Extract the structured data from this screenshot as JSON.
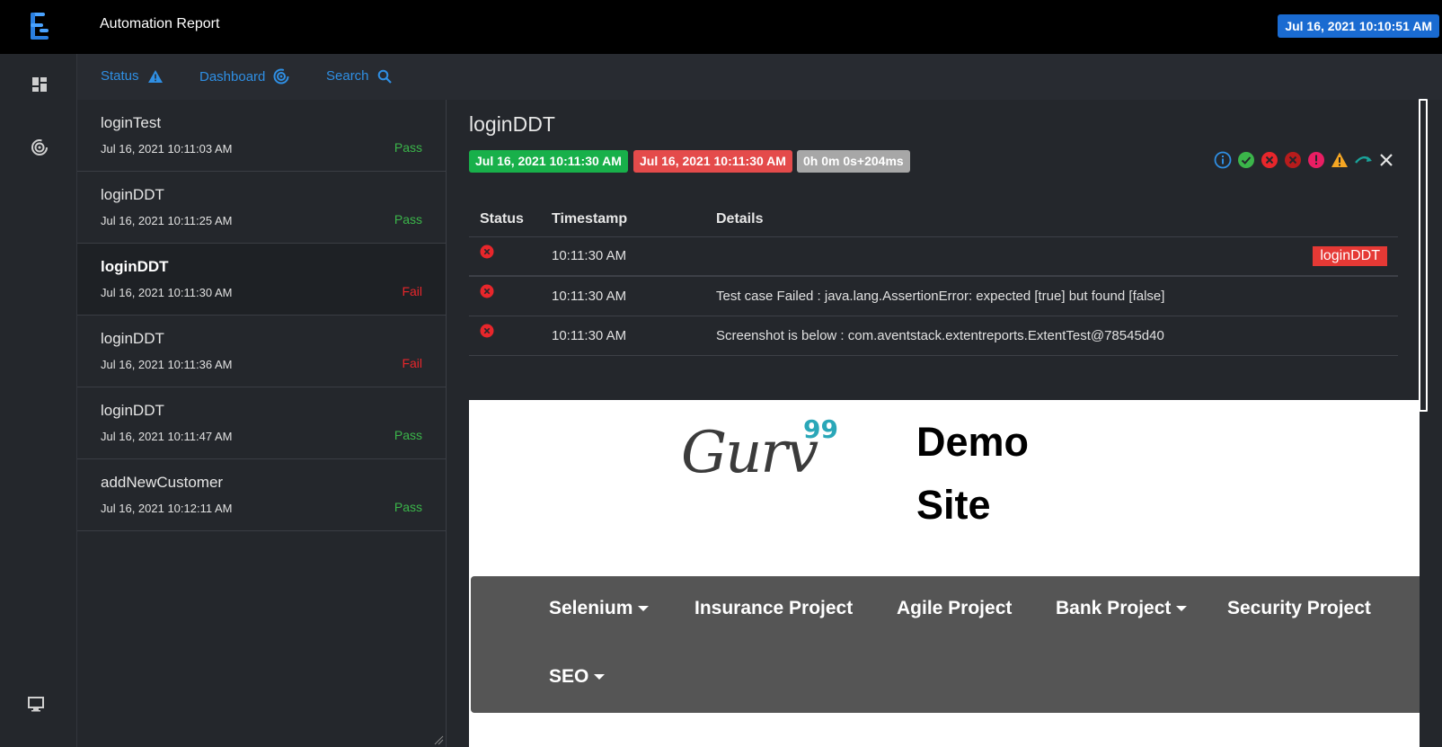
{
  "header": {
    "app_title": "Automation Report",
    "datetime": "Jul 16, 2021 10:10:51 AM",
    "logo_icon": "extent-logo-icon"
  },
  "rail": {
    "icons": [
      "dashboard-grid-icon",
      "radar-icon",
      "monitor-icon"
    ]
  },
  "nav": {
    "status_label": "Status",
    "status_icon": "warning-triangle-icon",
    "dashboard_label": "Dashboard",
    "dashboard_icon": "radar-icon",
    "search_label": "Search",
    "search_icon": "search-icon"
  },
  "tests": [
    {
      "name": "loginTest",
      "time": "Jul 16, 2021 10:11:03 AM",
      "status": "Pass"
    },
    {
      "name": "loginDDT",
      "time": "Jul 16, 2021 10:11:25 AM",
      "status": "Pass"
    },
    {
      "name": "loginDDT",
      "time": "Jul 16, 2021 10:11:30 AM",
      "status": "Fail"
    },
    {
      "name": "loginDDT",
      "time": "Jul 16, 2021 10:11:36 AM",
      "status": "Fail"
    },
    {
      "name": "loginDDT",
      "time": "Jul 16, 2021 10:11:47 AM",
      "status": "Pass"
    },
    {
      "name": "addNewCustomer",
      "time": "Jul 16, 2021 10:12:11 AM",
      "status": "Pass"
    }
  ],
  "detail": {
    "title": "loginDDT",
    "start_time": "Jul 16, 2021 10:11:30 AM",
    "end_time": "Jul 16, 2021 10:11:30 AM",
    "duration": "0h 0m 0s+204ms",
    "filter_icons": [
      "info-icon",
      "pass-check-icon",
      "fail-x-icon",
      "fatal-x-icon",
      "error-exclamation-icon",
      "warning-icon",
      "skip-arrow-icon",
      "close-icon"
    ],
    "log_headers": {
      "status": "Status",
      "timestamp": "Timestamp",
      "details": "Details"
    },
    "logs": [
      {
        "status": "fail",
        "timestamp": "10:11:30 AM",
        "details": "",
        "label": "loginDDT"
      },
      {
        "status": "fail",
        "timestamp": "10:11:30 AM",
        "details": "Test case Failed : java.lang.AssertionError: expected [true] but found [false]"
      },
      {
        "status": "fail",
        "timestamp": "10:11:30 AM",
        "details": "Screenshot is below : com.aventstack.extentreports.ExtentTest@78545d40"
      }
    ]
  },
  "screenshot": {
    "logo_text": "Gurv",
    "logo_number": "99",
    "demo_line1": "Demo",
    "demo_line2": "Site",
    "nav_items": [
      "Selenium",
      "Insurance Project",
      "Agile Project",
      "Bank Project",
      "Security Project",
      "SEO"
    ]
  },
  "colors": {
    "pass": "#3bb54a",
    "fail": "#e8262b",
    "accent": "#2f8fe4",
    "date_badge": "#1a6bd1"
  }
}
